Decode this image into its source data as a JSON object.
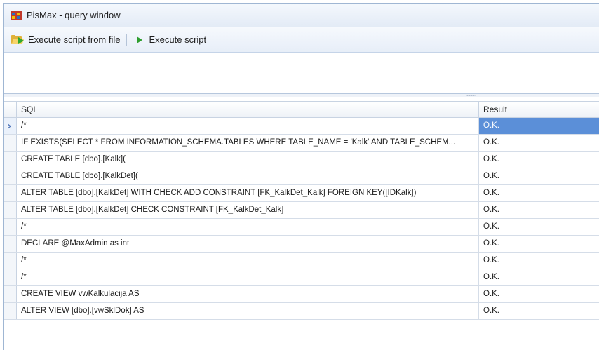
{
  "window": {
    "title": "PisMax - query window"
  },
  "toolbar": {
    "execute_from_file_label": "Execute script from file",
    "execute_label": "Execute script"
  },
  "grid": {
    "columns": {
      "sql": "SQL",
      "result": "Result"
    },
    "selected_row": 0,
    "rows": [
      {
        "sql": "/*",
        "result": "O.K."
      },
      {
        "sql": "IF EXISTS(SELECT * FROM INFORMATION_SCHEMA.TABLES WHERE TABLE_NAME = 'Kalk' AND TABLE_SCHEM...",
        "result": "O.K."
      },
      {
        "sql": "CREATE TABLE [dbo].[Kalk](",
        "result": "O.K."
      },
      {
        "sql": "CREATE TABLE [dbo].[KalkDet](",
        "result": "O.K."
      },
      {
        "sql": "ALTER TABLE [dbo].[KalkDet]  WITH CHECK ADD  CONSTRAINT [FK_KalkDet_Kalk] FOREIGN KEY([IDKalk])",
        "result": "O.K."
      },
      {
        "sql": "ALTER TABLE [dbo].[KalkDet] CHECK CONSTRAINT [FK_KalkDet_Kalk]",
        "result": "O.K."
      },
      {
        "sql": "/*",
        "result": "O.K."
      },
      {
        "sql": "DECLARE @MaxAdmin as int",
        "result": "O.K."
      },
      {
        "sql": "/*",
        "result": "O.K."
      },
      {
        "sql": "/*",
        "result": "O.K."
      },
      {
        "sql": "CREATE VIEW vwKalkulacija AS",
        "result": "O.K."
      },
      {
        "sql": "ALTER VIEW [dbo].[vwSklDok] AS",
        "result": "O.K."
      }
    ]
  },
  "colors": {
    "selection": "#5b8fd8",
    "header_gradient_top": "#f4f8fd",
    "border": "#9fb6d3"
  },
  "icons": {
    "app": "app-window-icon",
    "execute_from_file": "folder-run-icon",
    "execute": "play-icon"
  }
}
